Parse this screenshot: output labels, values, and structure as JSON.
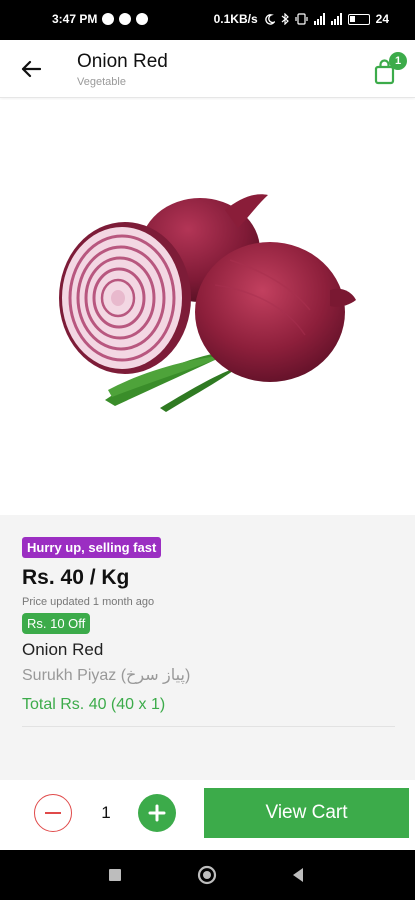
{
  "status_bar": {
    "time": "3:47 PM",
    "network_speed": "0.1KB/s",
    "battery": "24"
  },
  "header": {
    "title": "Onion Red",
    "subtitle": "Vegetable",
    "cart_count": "1",
    "back_icon": "arrow-left-icon",
    "cart_icon": "shopping-bag-icon"
  },
  "product": {
    "urgency_badge": "Hurry up, selling fast",
    "price": "Rs. 40 / Kg",
    "price_updated": "Price updated 1 month ago",
    "discount_badge": "Rs. 10 Off",
    "name": "Onion Red",
    "local_name": "Surukh Piyaz (پیاز سرخ)",
    "total": "Total Rs. 40 (40 x 1)"
  },
  "actions": {
    "quantity": "1",
    "view_cart_label": "View Cart"
  },
  "colors": {
    "accent_green": "#3cab4a",
    "urgency_purple": "#9b2ec2",
    "minus_red": "#e04a4a"
  }
}
